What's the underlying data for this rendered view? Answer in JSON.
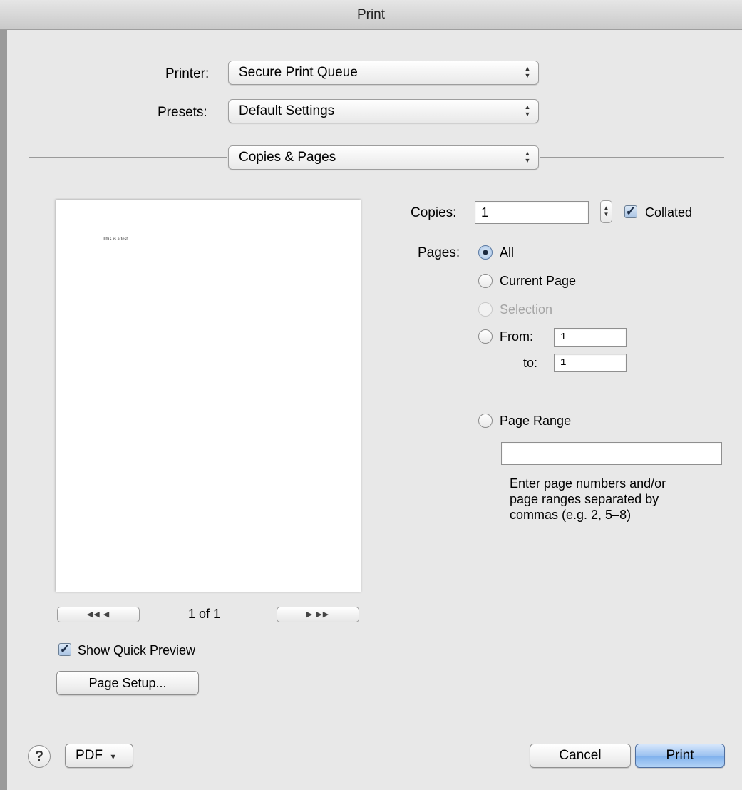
{
  "window": {
    "title": "Print"
  },
  "printer": {
    "label": "Printer:",
    "value": "Secure Print Queue"
  },
  "presets": {
    "label": "Presets:",
    "value": "Default Settings"
  },
  "section": {
    "value": "Copies & Pages"
  },
  "preview": {
    "page_text": "This is a test.",
    "page_indicator": "1 of 1",
    "first_prev_glyphs": "◀◀ ◀",
    "next_last_glyphs": "▶ ▶▶",
    "show_quick_preview_label": "Show Quick Preview",
    "show_quick_preview_checked": true
  },
  "copies": {
    "label": "Copies:",
    "value": "1",
    "collated_label": "Collated",
    "collated_checked": true
  },
  "pages": {
    "label": "Pages:",
    "options": {
      "all": "All",
      "current": "Current Page",
      "selection": "Selection",
      "from": "From:",
      "to": "to:",
      "range": "Page Range"
    },
    "selected": "All",
    "from_value": "1",
    "to_value": "1",
    "range_value": "",
    "range_hint_line1": "Enter page numbers and/or",
    "range_hint_line2": "page ranges separated by",
    "range_hint_line3": "commas (e.g. 2, 5–8)"
  },
  "buttons": {
    "page_setup": "Page Setup...",
    "help": "?",
    "pdf": "PDF",
    "cancel": "Cancel",
    "print": "Print"
  },
  "icons": {
    "popup_arrows": "up-down-arrows-icon",
    "check": "checkmark-icon",
    "dropdown": "dropdown-triangle-icon"
  },
  "colors": {
    "default_button": "#8db8ee",
    "window_bg": "#e8e8e8"
  }
}
